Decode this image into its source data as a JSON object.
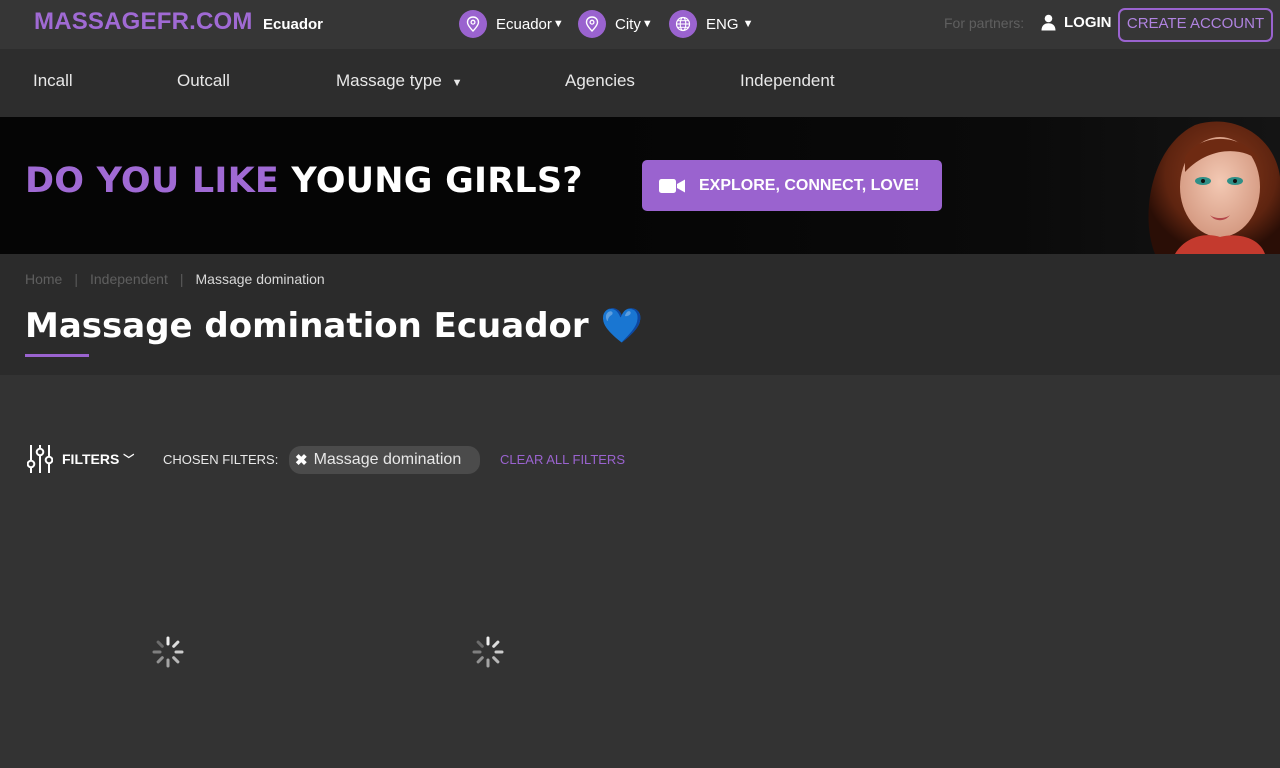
{
  "topbar": {
    "logo": "MASSAGEFR.COM",
    "logo_country": "Ecuador",
    "country_select": "Ecuador",
    "city_select": "City",
    "language_select": "ENG",
    "partners_label": "For partners:",
    "login_label": "LOGIN",
    "create_account_label": "CREATE ACCOUNT"
  },
  "nav": {
    "items": [
      "Incall",
      "Outcall",
      "Massage type",
      "Agencies",
      "Independent"
    ]
  },
  "banner": {
    "headline_part1": "DO YOU LIKE",
    "headline_part2": "YOUNG GIRLS?",
    "button_label": "EXPLORE, CONNECT, LOVE!"
  },
  "breadcrumb": {
    "items": [
      "Home",
      "Independent",
      "Massage domination"
    ]
  },
  "page": {
    "title": "Massage domination Ecuador",
    "title_emoji": "💙"
  },
  "filters": {
    "toggle_label": "FILTERS",
    "chosen_label": "CHOSEN FILTERS:",
    "chips": [
      "Massage domination"
    ],
    "clear_all_label": "CLEAR ALL FILTERS"
  },
  "icons": {
    "location": "map-pin-icon",
    "globe": "globe-icon",
    "user": "user-icon",
    "video": "video-camera-icon",
    "filters": "sliders-icon",
    "loading": "spinner-icon"
  },
  "colors": {
    "accent": "#9a63cf",
    "background": "#333333",
    "topbar": "#363636",
    "nav": "#2d2d2d"
  }
}
